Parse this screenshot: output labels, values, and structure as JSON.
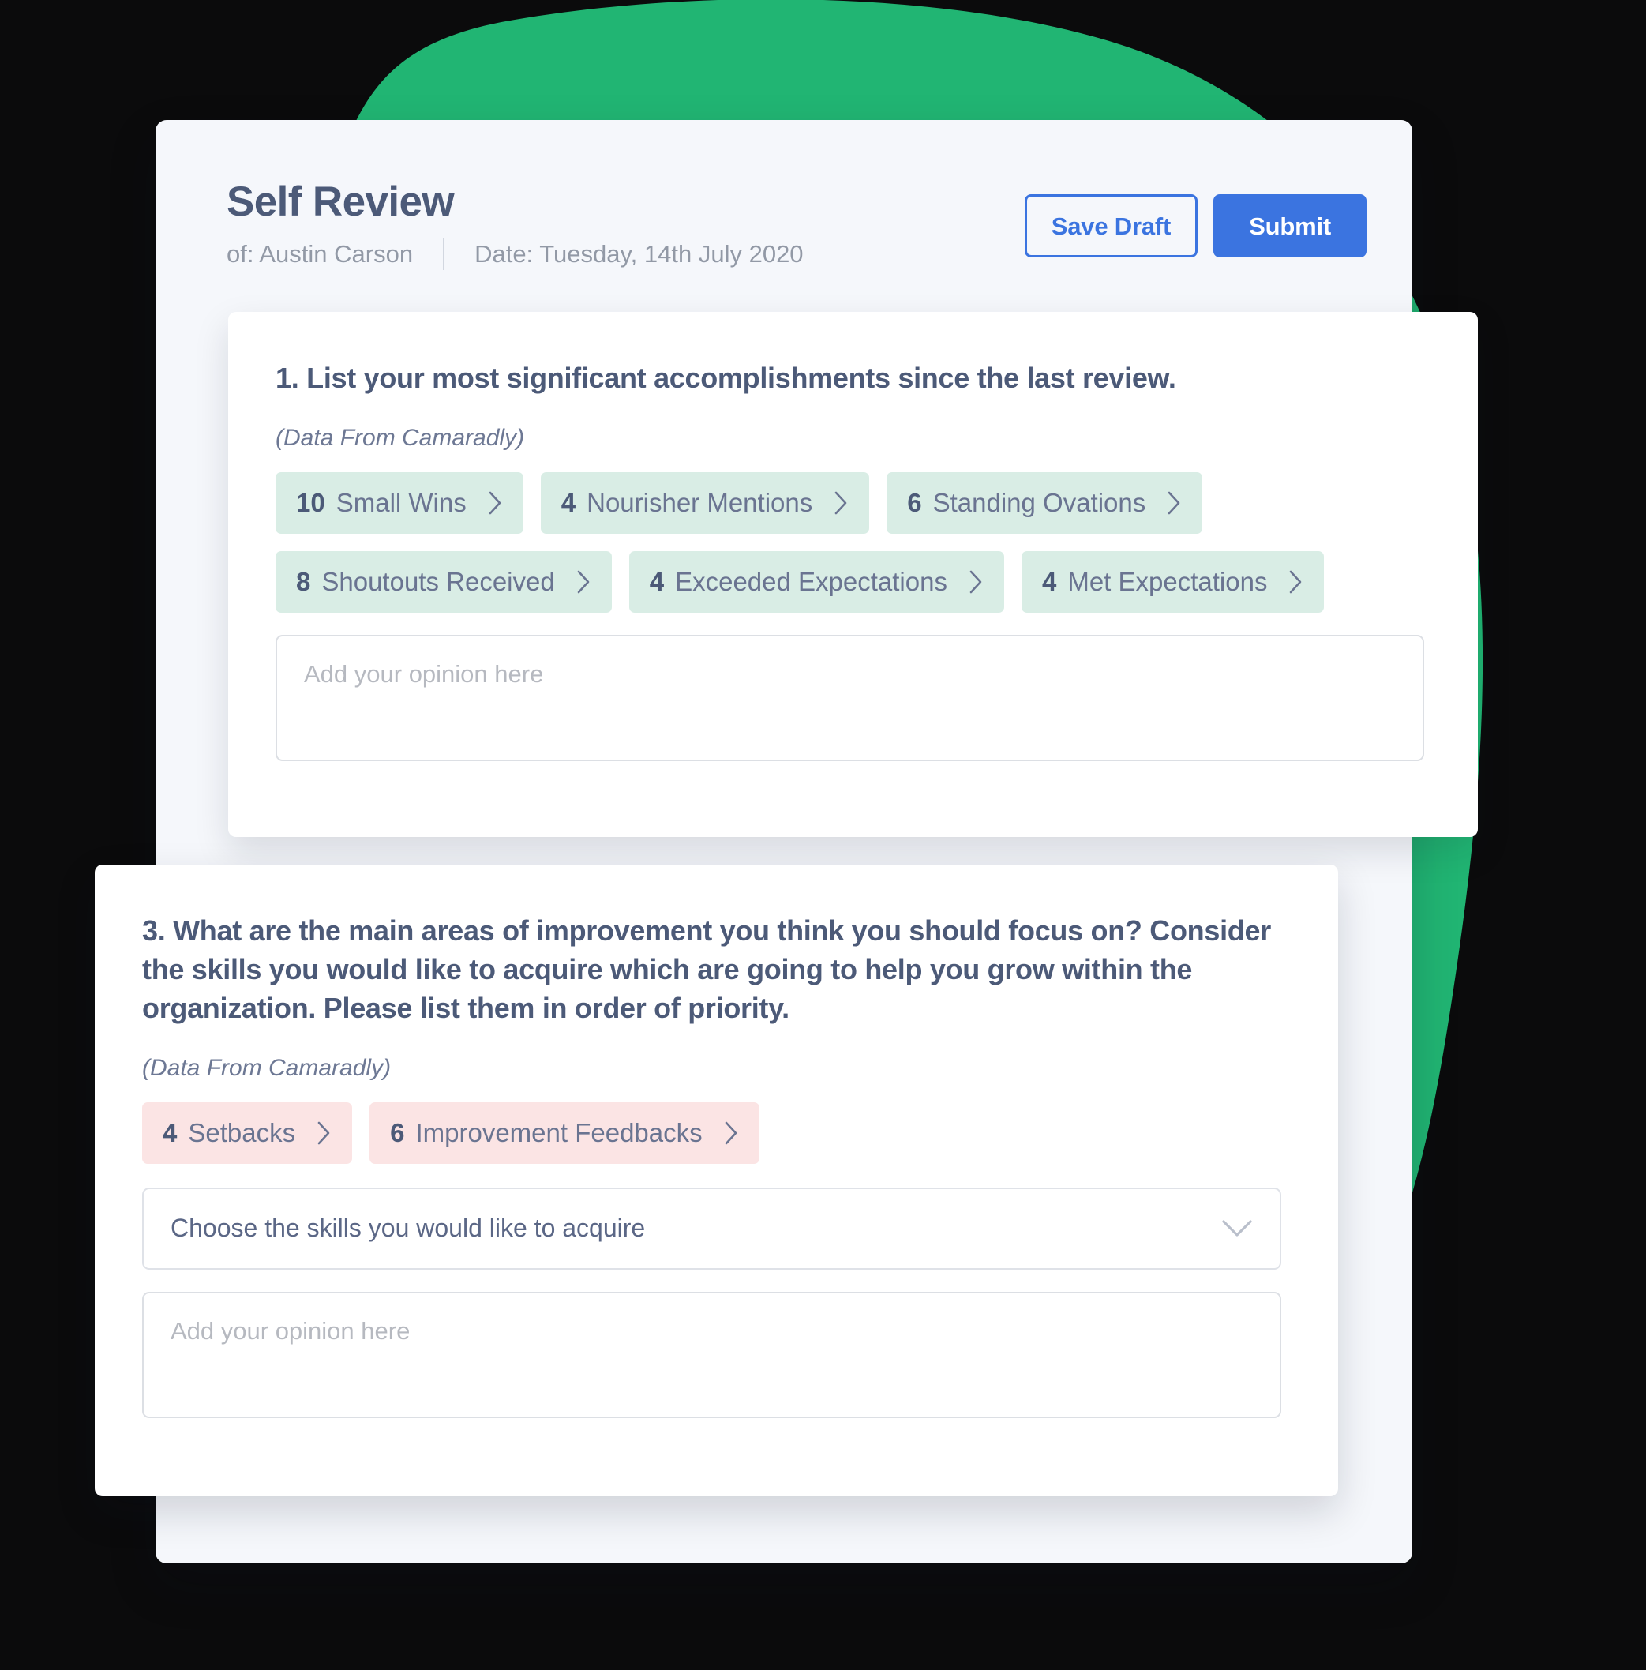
{
  "theme": {
    "background": "#0b0b0c",
    "blob_green": "#21b573",
    "shell_card": "#f5f7fb",
    "accent_blue": "#3b74e0",
    "heading_slate": "#4c5a78",
    "chip_green_bg": "#d9ede5",
    "chip_pink_bg": "#fbe4e4"
  },
  "header": {
    "title": "Self Review",
    "owner": "of: Austin Carson",
    "date": "Date: Tuesday, 14th July 2020",
    "save_draft_label": "Save Draft",
    "submit_label": "Submit"
  },
  "questions": [
    {
      "id": "q1",
      "title": "1. List your most significant accomplishments since the last review.",
      "source_note": "(Data From Camaradly)",
      "chip_rows": [
        [
          {
            "count": "10",
            "label": "Small Wins"
          },
          {
            "count": "4",
            "label": "Nourisher Mentions"
          },
          {
            "count": "6",
            "label": "Standing Ovations"
          }
        ],
        [
          {
            "count": "8",
            "label": "Shoutouts Received"
          },
          {
            "count": "4",
            "label": "Exceeded Expectations"
          },
          {
            "count": "4",
            "label": "Met Expectations"
          }
        ]
      ],
      "opinion_placeholder": "Add your opinion here",
      "opinion_value": ""
    },
    {
      "id": "q3",
      "title": "3. What are the main areas of improvement you think you should focus on? Consider the skills you would like to acquire which are going to help you grow within the organization. Please list them in order of priority.",
      "source_note": "(Data From Camaradly)",
      "chip_rows": [
        [
          {
            "count": "4",
            "label": "Setbacks"
          },
          {
            "count": "6",
            "label": "Improvement Feedbacks"
          }
        ]
      ],
      "skills_select_label": "Choose the skills you would like to acquire",
      "opinion_placeholder": "Add your opinion here",
      "opinion_value": ""
    }
  ]
}
